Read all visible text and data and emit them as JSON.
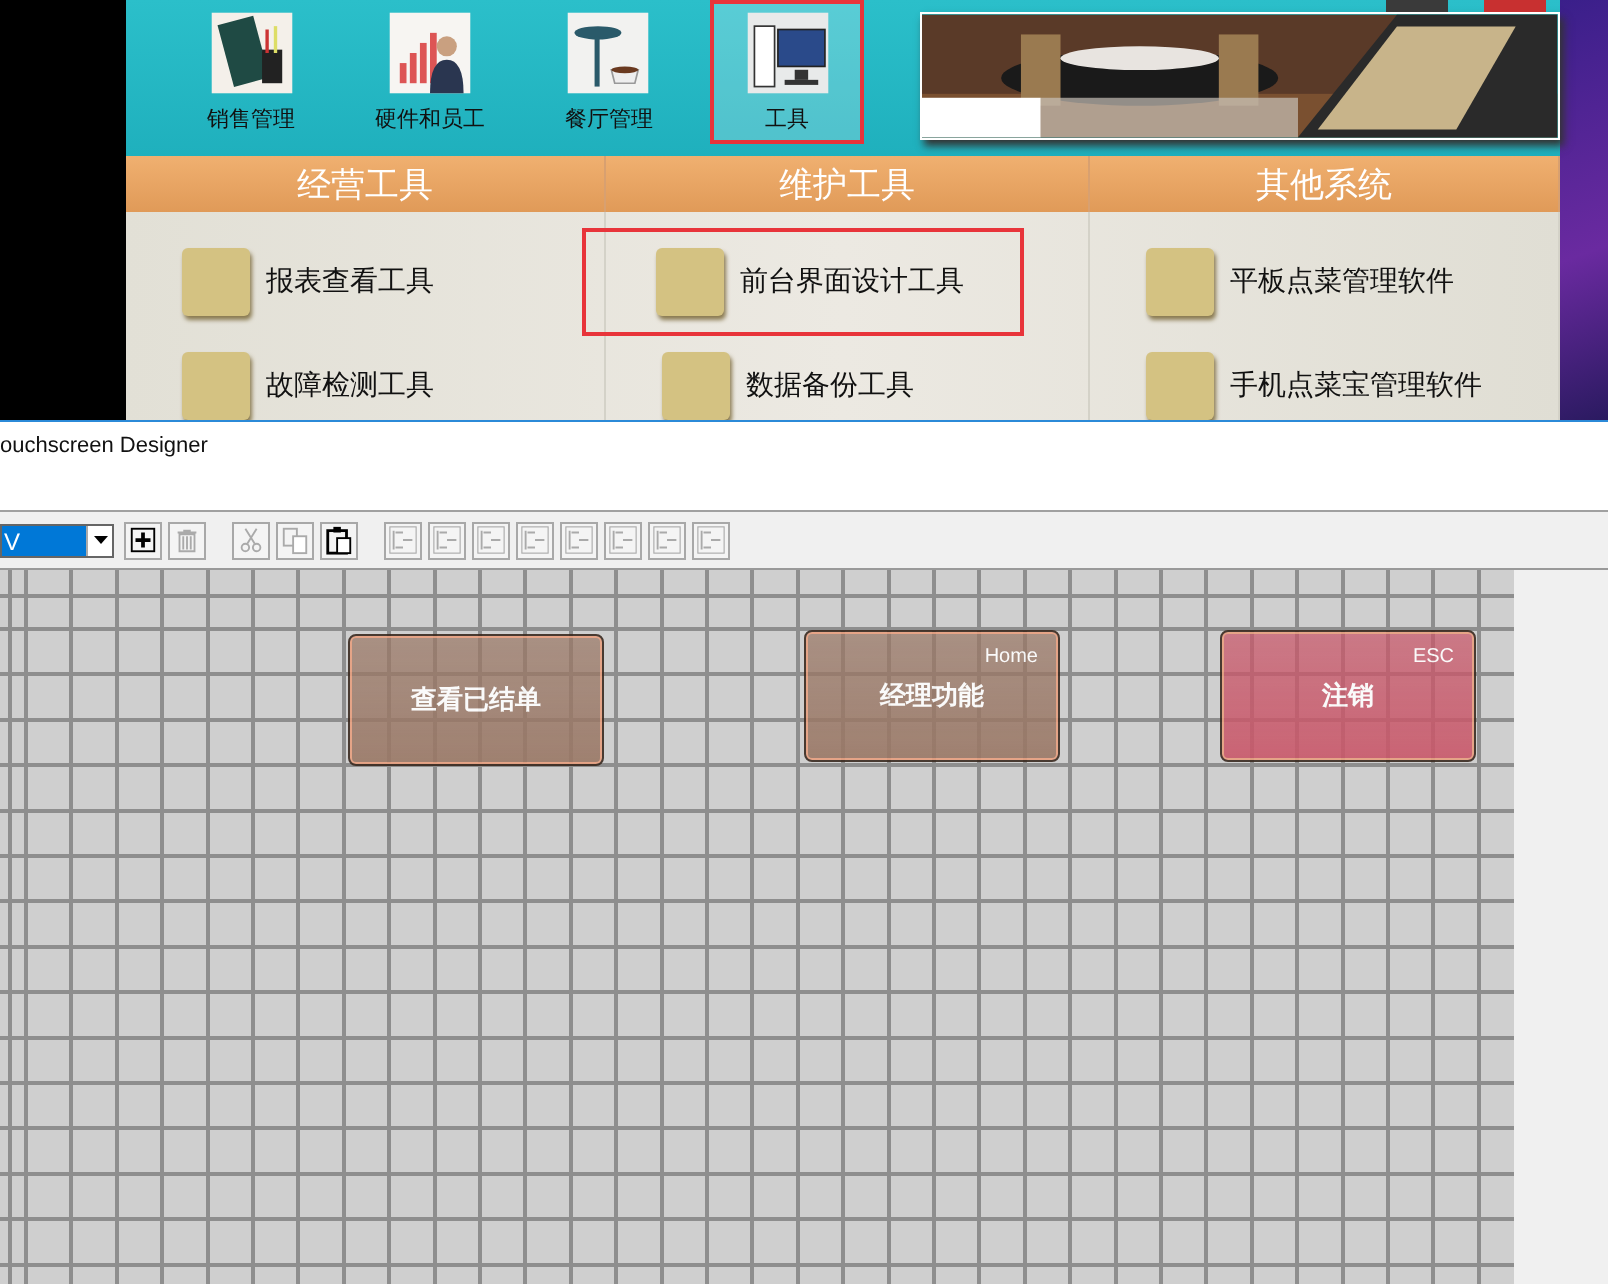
{
  "back_window": {
    "nav": [
      {
        "label": "销售管理",
        "selected": false,
        "annotated": false
      },
      {
        "label": "硬件和员工",
        "selected": false,
        "annotated": false
      },
      {
        "label": "餐厅管理",
        "selected": false,
        "annotated": false
      },
      {
        "label": "工具",
        "selected": true,
        "annotated": true
      }
    ],
    "columns": [
      {
        "heading": "经营工具",
        "items": [
          {
            "label": "报表查看工具",
            "annotated": false
          },
          {
            "label": "故障检测工具",
            "annotated": false
          }
        ]
      },
      {
        "heading": "维护工具",
        "items": [
          {
            "label": "前台界面设计工具",
            "annotated": true
          },
          {
            "label": "数据备份工具",
            "annotated": false
          }
        ]
      },
      {
        "heading": "其他系统",
        "items": [
          {
            "label": "平板点菜管理软件",
            "annotated": false
          },
          {
            "label": "手机点菜宝管理软件",
            "annotated": false
          }
        ]
      }
    ]
  },
  "designer": {
    "title": "ouchscreen Designer",
    "dropdown": {
      "value": "V"
    },
    "toolbar": [
      {
        "kind": "add",
        "disabled": false
      },
      {
        "kind": "delete",
        "disabled": true
      },
      {
        "kind": "cut",
        "disabled": true
      },
      {
        "kind": "copy",
        "disabled": true
      },
      {
        "kind": "paste",
        "disabled": false
      },
      {
        "kind": "align-left",
        "disabled": true
      },
      {
        "kind": "align-right",
        "disabled": true
      },
      {
        "kind": "align-top",
        "disabled": true
      },
      {
        "kind": "align-bottom",
        "disabled": true
      },
      {
        "kind": "space-vertical",
        "disabled": true
      },
      {
        "kind": "space-horizontal",
        "disabled": true
      },
      {
        "kind": "same-width",
        "disabled": true
      },
      {
        "kind": "same-height",
        "disabled": true
      }
    ],
    "canvas_buttons": [
      {
        "label": "查看已结单",
        "color": "#9a7866"
      },
      {
        "label": "经理功能",
        "hotkey": "Home",
        "color": "#9a7866"
      },
      {
        "label": "注销",
        "hotkey": "ESC",
        "color": "#c9586a"
      }
    ]
  }
}
